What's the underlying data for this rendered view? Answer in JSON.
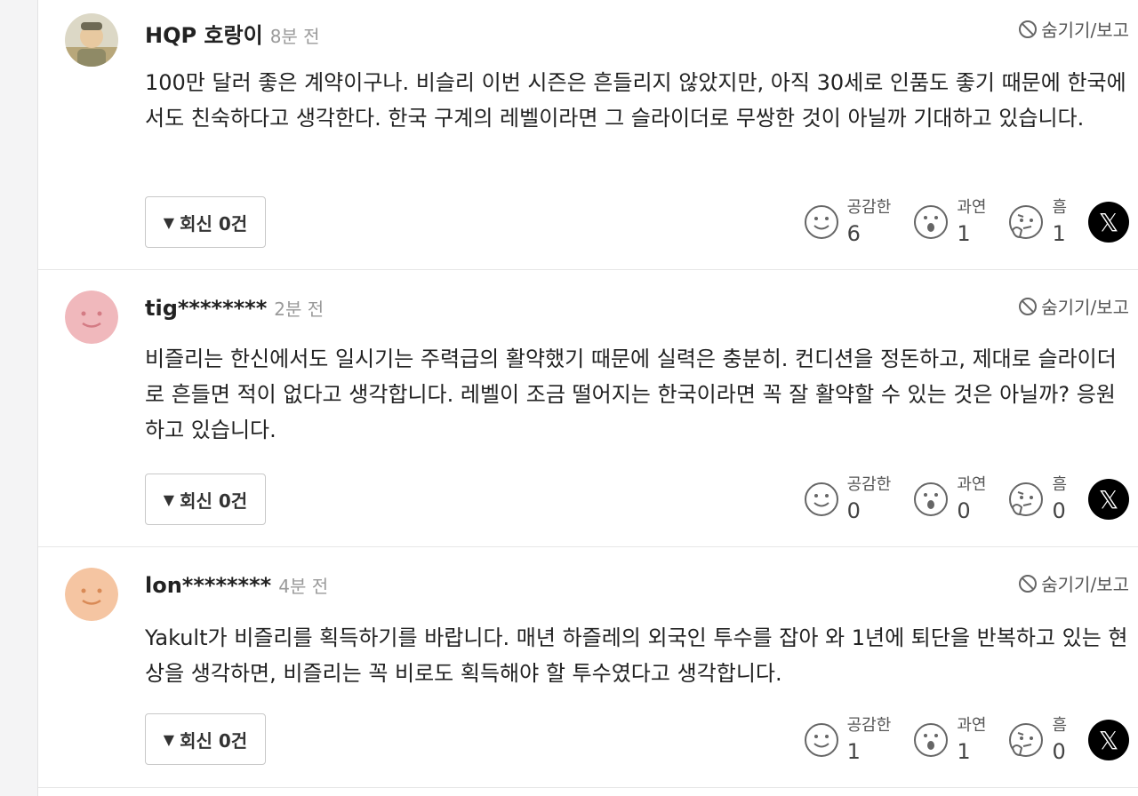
{
  "comments": [
    {
      "username": "HQP 호랑이",
      "time": "8분 전",
      "hide_label": "숨기기/보고",
      "text": "100만 달러 좋은 계약이구나. 비슬리 이번 시즌은 흔들리지 않았지만, 아직 30세로 인품도 좋기 때문에 한국에서도 친숙하다고 생각한다. 한국 구계의 레벨이라면 그 슬라이더로 무쌍한 것이 아닐까 기대하고 있습니다.",
      "reply_label": "회신 0건",
      "reactions": [
        {
          "label": "공감한",
          "count": "6",
          "icon": "smile-icon"
        },
        {
          "label": "과연",
          "count": "1",
          "icon": "surprised-icon"
        },
        {
          "label": "흠",
          "count": "1",
          "icon": "thinking-icon"
        }
      ],
      "avatar_color": "#c8c2a8"
    },
    {
      "username": "tig********",
      "time": "2분 전",
      "hide_label": "숨기기/보고",
      "text": "비즐리는 한신에서도 일시기는 주력급의 활약했기 때문에 실력은 충분히. 컨디션을 정돈하고, 제대로 슬라이더로 흔들면 적이 없다고 생각합니다. 레벨이 조금 떨어지는 한국이라면 꼭 잘 활약할 수 있는 것은 아닐까? 응원하고 있습니다.",
      "reply_label": "회신 0건",
      "reactions": [
        {
          "label": "공감한",
          "count": "0",
          "icon": "smile-icon"
        },
        {
          "label": "과연",
          "count": "0",
          "icon": "surprised-icon"
        },
        {
          "label": "흠",
          "count": "0",
          "icon": "thinking-icon"
        }
      ],
      "avatar_color": "#f0b8bc"
    },
    {
      "username": "lon********",
      "time": "4분 전",
      "hide_label": "숨기기/보고",
      "text": "Yakult가 비즐리를 획득하기를 바랍니다. 매년 하즐레의 외국인 투수를 잡아 와 1년에 퇴단을 반복하고 있는 현상을 생각하면, 비즐리는 꼭 비로도 획득해야 할 투수였다고 생각합니다.",
      "reply_label": "회신 0건",
      "reactions": [
        {
          "label": "공감한",
          "count": "1",
          "icon": "smile-icon"
        },
        {
          "label": "과연",
          "count": "1",
          "icon": "surprised-icon"
        },
        {
          "label": "흠",
          "count": "0",
          "icon": "thinking-icon"
        }
      ],
      "avatar_color": "#f5c5a2"
    }
  ],
  "share": {
    "icon": "x-logo-icon",
    "glyph": "𝕏"
  }
}
